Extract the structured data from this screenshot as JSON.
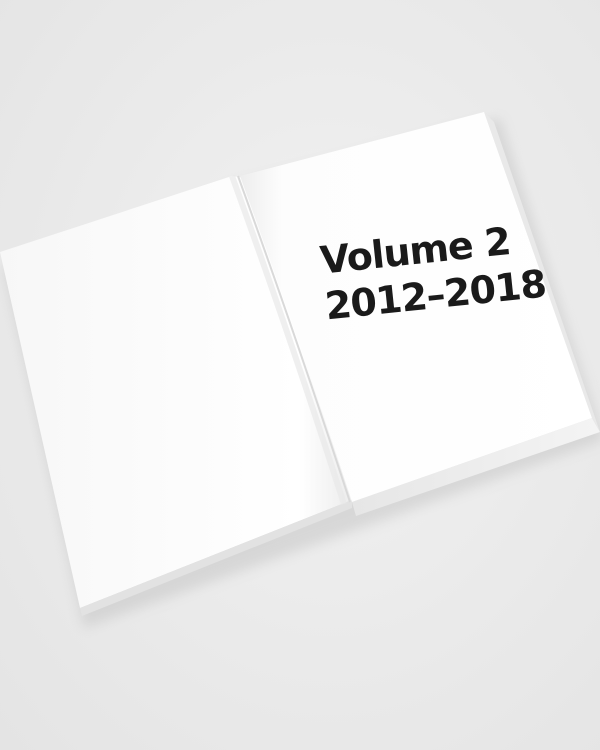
{
  "book": {
    "title_line_1": "Volume 2",
    "title_line_2": "2012–2018"
  },
  "colors": {
    "background": "#ededed",
    "page": "#ffffff",
    "text": "#1a1a1a"
  }
}
